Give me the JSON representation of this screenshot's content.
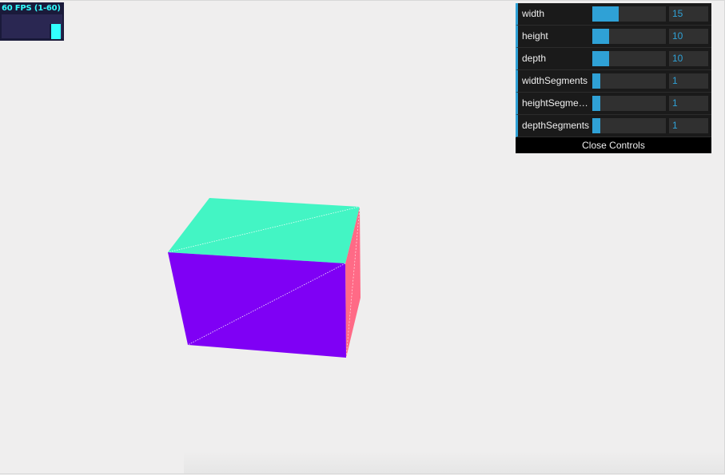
{
  "stats": {
    "fps_text": "60 FPS (1-60)",
    "fps": 60,
    "min": 1,
    "max": 60
  },
  "gui": {
    "controllers": [
      {
        "label": "width",
        "value": "15",
        "min": 1,
        "max": 40
      },
      {
        "label": "height",
        "value": "10",
        "min": 1,
        "max": 40
      },
      {
        "label": "depth",
        "value": "10",
        "min": 1,
        "max": 40
      },
      {
        "label": "widthSegments",
        "value": "1",
        "min": 1,
        "max": 10
      },
      {
        "label": "heightSegme…",
        "value": "1",
        "min": 1,
        "max": 10
      },
      {
        "label": "depthSegments",
        "value": "1",
        "min": 1,
        "max": 10
      }
    ],
    "close_label": "Close Controls"
  },
  "colors": {
    "background": "#efeeee",
    "gui_accent": "#2fa1d6",
    "stats_text": "#33ffff",
    "cube_top": "#43f5c4",
    "cube_front": "#7f00f5",
    "cube_side": "#ff6080"
  }
}
